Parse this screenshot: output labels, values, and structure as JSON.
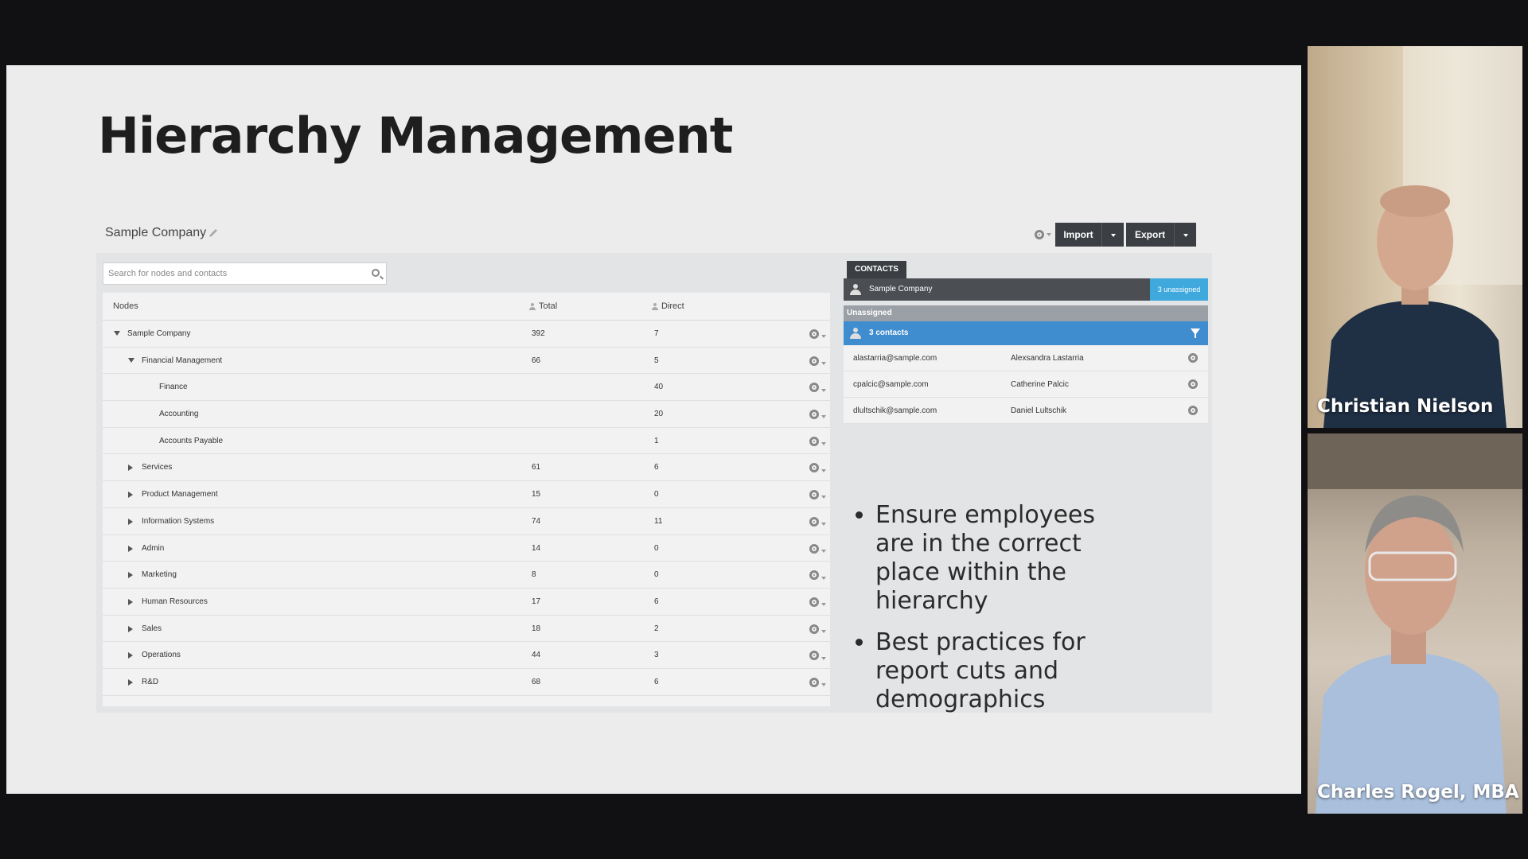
{
  "slide": {
    "title": "Hierarchy Management",
    "company_name": "Sample Company",
    "toolbar": {
      "import_label": "Import",
      "export_label": "Export"
    },
    "search_placeholder": "Search for nodes and contacts",
    "columns": {
      "nodes": "Nodes",
      "total": "Total",
      "direct": "Direct"
    },
    "nodes": [
      {
        "name": "Sample Company",
        "total": "392",
        "direct": "7",
        "depth": 0,
        "toggle": "expanded"
      },
      {
        "name": "Financial Management",
        "total": "66",
        "direct": "5",
        "depth": 1,
        "toggle": "expanded"
      },
      {
        "name": "Finance",
        "total": "",
        "direct": "40",
        "depth": 2,
        "toggle": "none"
      },
      {
        "name": "Accounting",
        "total": "",
        "direct": "20",
        "depth": 2,
        "toggle": "none"
      },
      {
        "name": "Accounts Payable",
        "total": "",
        "direct": "1",
        "depth": 2,
        "toggle": "none"
      },
      {
        "name": "Services",
        "total": "61",
        "direct": "6",
        "depth": 1,
        "toggle": "collapsed"
      },
      {
        "name": "Product Management",
        "total": "15",
        "direct": "0",
        "depth": 1,
        "toggle": "collapsed"
      },
      {
        "name": "Information Systems",
        "total": "74",
        "direct": "11",
        "depth": 1,
        "toggle": "collapsed"
      },
      {
        "name": "Admin",
        "total": "14",
        "direct": "0",
        "depth": 1,
        "toggle": "collapsed"
      },
      {
        "name": "Marketing",
        "total": "8",
        "direct": "0",
        "depth": 1,
        "toggle": "collapsed"
      },
      {
        "name": "Human Resources",
        "total": "17",
        "direct": "6",
        "depth": 1,
        "toggle": "collapsed"
      },
      {
        "name": "Sales",
        "total": "18",
        "direct": "2",
        "depth": 1,
        "toggle": "collapsed"
      },
      {
        "name": "Operations",
        "total": "44",
        "direct": "3",
        "depth": 1,
        "toggle": "collapsed"
      },
      {
        "name": "R&D",
        "total": "68",
        "direct": "6",
        "depth": 1,
        "toggle": "collapsed"
      }
    ],
    "contacts": {
      "tab_label": "CONTACTS",
      "company": "Sample Company",
      "unassigned_badge": "3 unassigned",
      "unassigned_header": "Unassigned",
      "count_label": "3 contacts",
      "rows": [
        {
          "email": "alastarria@sample.com",
          "name": "Alexsandra Lastarria"
        },
        {
          "email": "cpalcic@sample.com",
          "name": "Catherine Palcic"
        },
        {
          "email": "dlultschik@sample.com",
          "name": "Daniel Lultschik"
        }
      ]
    },
    "bullets": [
      "Ensure employees are in the correct place within the hierarchy",
      "Best practices for report cuts and demographics"
    ]
  },
  "participants": [
    {
      "name": "Christian Nielson"
    },
    {
      "name": "Charles Rogel, MBA"
    }
  ],
  "colors": {
    "accent_blue": "#3f8ccf",
    "badge_blue": "#3fa9dd",
    "dark_button": "#3b3e42"
  }
}
